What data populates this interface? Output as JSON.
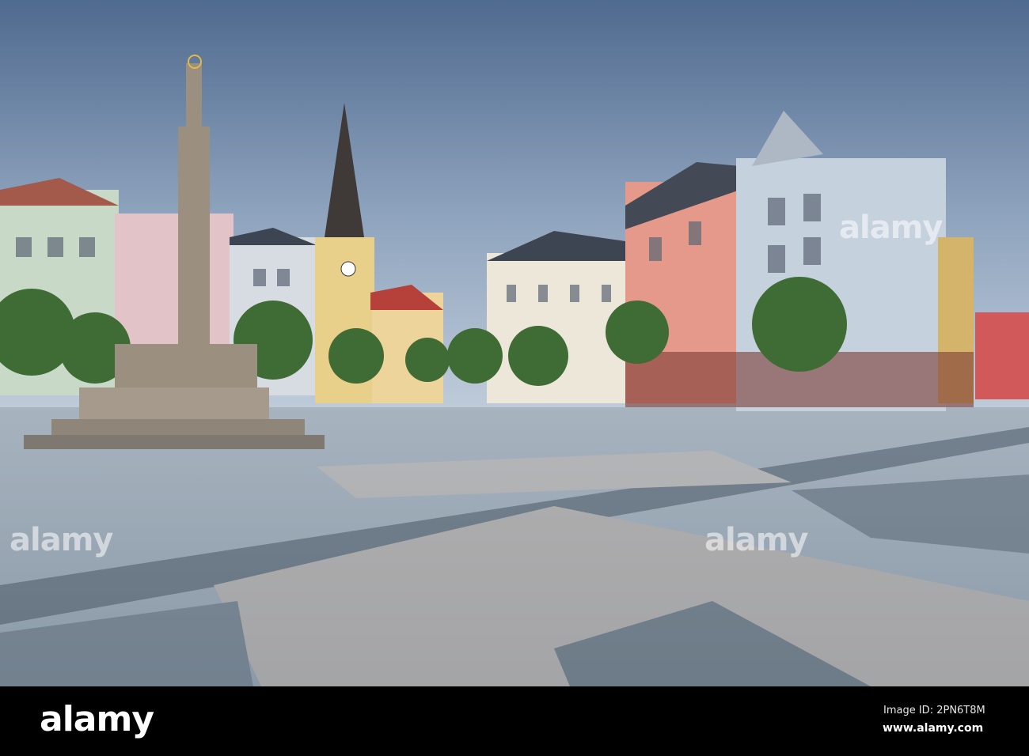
{
  "watermark": {
    "logo": "alamy",
    "image_id": "Image ID: 2PN6T8M",
    "site": "www.alamy.com",
    "overlay_text": "alamy"
  },
  "colors": {
    "sky_top": "#4f6a8f",
    "sky_bottom": "#b8c7d8",
    "pavement": "#8fa2b3",
    "bar": "#000000"
  }
}
